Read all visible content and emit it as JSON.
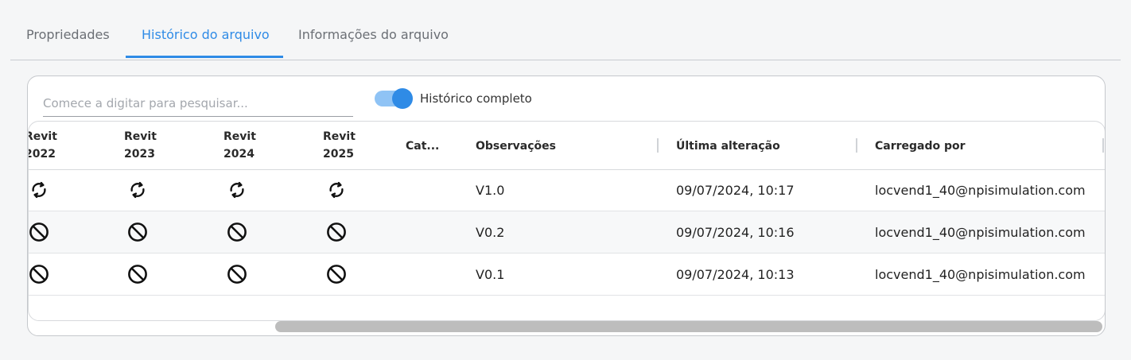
{
  "tabs": [
    {
      "label": "Propriedades",
      "active": false
    },
    {
      "label": "Histórico do arquivo",
      "active": true
    },
    {
      "label": "Informações do arquivo",
      "active": false
    }
  ],
  "search": {
    "placeholder": "Comece a digitar para pesquisar...",
    "value": ""
  },
  "toggle": {
    "label": "Histórico completo",
    "on": true
  },
  "table": {
    "headers": {
      "revit2022_a": "Revit",
      "revit2022_b": "2022",
      "revit2023_a": "Revit",
      "revit2023_b": "2023",
      "revit2024_a": "Revit",
      "revit2024_b": "2024",
      "revit2025_a": "Revit",
      "revit2025_b": "2025",
      "category": "Cat...",
      "notes": "Observações",
      "modified": "Última alteração",
      "uploaded_by": "Carregado por"
    },
    "rows": [
      {
        "status_icon": "sync-icon",
        "notes": "V1.0",
        "modified": "09/07/2024, 10:17",
        "uploaded_by": "locvend1_40@npisimulation.com"
      },
      {
        "status_icon": "blocked-icon",
        "notes": "V0.2",
        "modified": "09/07/2024, 10:16",
        "uploaded_by": "locvend1_40@npisimulation.com"
      },
      {
        "status_icon": "blocked-icon",
        "notes": "V0.1",
        "modified": "09/07/2024, 10:13",
        "uploaded_by": "locvend1_40@npisimulation.com"
      }
    ]
  },
  "colors": {
    "accent": "#2f8be6",
    "toggle_track": "#8fc3f5",
    "scrollbar": "#bdbdbd"
  }
}
